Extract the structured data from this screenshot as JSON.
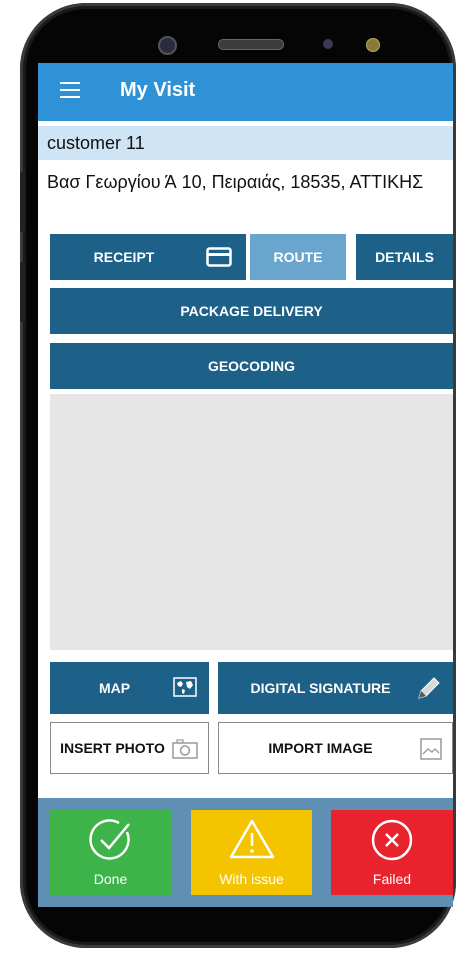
{
  "app_bar": {
    "title": "My Visit",
    "menu_icon": "hamburger-menu-icon"
  },
  "customer": {
    "name": "customer 11"
  },
  "address": {
    "line": "Βασ Γεωργίου Ά 10, Πειραιάς, 18535, ΑΤΤΙΚΗΣ"
  },
  "tabs": {
    "receipt": "RECEIPT",
    "route": "ROUTE",
    "details": "DETAILS"
  },
  "actions": {
    "package_delivery": "PACKAGE DELIVERY",
    "geocoding": "GEOCODING",
    "map": "MAP",
    "digital_signature": "DIGITAL SIGNATURE",
    "insert_photo": "INSERT PHOTO",
    "import_image": "IMPORT IMAGE"
  },
  "status": {
    "done": "Done",
    "with_issue": "With issue",
    "failed": "Failed"
  },
  "colors": {
    "app_bar": "#3092d6",
    "button_dark": "#1d6189",
    "button_selected": "#6aa5cd",
    "customer_bg": "#cfe4f5",
    "done": "#3db34a",
    "issue": "#f5c400",
    "failed": "#e8232d"
  }
}
